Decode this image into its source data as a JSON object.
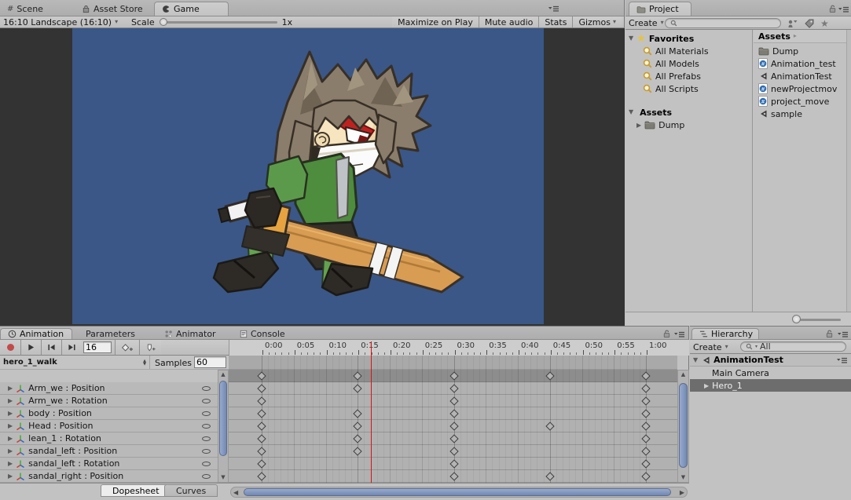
{
  "game_panel": {
    "tabs": [
      {
        "label": "Scene",
        "icon": "scene-icon",
        "active": false
      },
      {
        "label": "Asset Store",
        "icon": "asset-store-icon",
        "active": false
      },
      {
        "label": "Game",
        "icon": "game-icon",
        "active": true
      }
    ],
    "toolbar": {
      "aspect_dropdown": "16:10 Landscape (16:10)",
      "scale_label": "Scale",
      "scale_value": "1x",
      "maximize_on_play": "Maximize on Play",
      "mute_audio": "Mute audio",
      "stats": "Stats",
      "gizmos": "Gizmos"
    }
  },
  "project_panel": {
    "tab": "Project",
    "create_button": "Create",
    "search_placeholder": "",
    "favorites": {
      "label": "Favorites",
      "items": [
        "All Materials",
        "All Models",
        "All Prefabs",
        "All Scripts"
      ]
    },
    "assets_tree": {
      "label": "Assets",
      "children": [
        {
          "name": "Dump"
        }
      ]
    },
    "assets_list": {
      "header": "Assets",
      "items": [
        {
          "name": "Dump",
          "icon": "folder"
        },
        {
          "name": "Animation_test",
          "icon": "csharp-script"
        },
        {
          "name": "AnimationTest",
          "icon": "unity-asset"
        },
        {
          "name": "newProjectmov",
          "icon": "csharp-script"
        },
        {
          "name": "project_move",
          "icon": "csharp-script"
        },
        {
          "name": "sample",
          "icon": "unity-asset"
        }
      ]
    }
  },
  "animation_panel": {
    "tabs": [
      {
        "label": "Animation",
        "icon": "clock-icon",
        "active": true
      },
      {
        "label": "Parameters",
        "icon": "",
        "active": false
      },
      {
        "label": "Animator",
        "icon": "animator-icon",
        "active": false
      },
      {
        "label": "Console",
        "icon": "console-icon",
        "active": false
      }
    ],
    "transport": {
      "frame_value": "16"
    },
    "clip_selector": "hero_1_walk",
    "samples_label": "Samples",
    "samples_value": "60",
    "timeline": {
      "tick_labels": [
        "0:00",
        "0:05",
        "0:10",
        "0:15",
        "0:20",
        "0:25",
        "0:30",
        "0:35",
        "0:40",
        "0:45",
        "0:50",
        "0:55",
        "1:00"
      ],
      "total_frames": 60,
      "playhead_frame": 17
    },
    "dopesheet": {
      "summary_keys": [
        0,
        15,
        30,
        45,
        60
      ],
      "rows": [
        {
          "name": "Arm_we : Position",
          "keys": [
            0,
            15,
            30,
            60
          ]
        },
        {
          "name": "Arm_we : Rotation",
          "keys": [
            0,
            30,
            60
          ]
        },
        {
          "name": "body : Position",
          "keys": [
            0,
            15,
            30,
            60
          ]
        },
        {
          "name": "Head : Position",
          "keys": [
            0,
            15,
            30,
            45,
            60
          ]
        },
        {
          "name": "lean_1 : Rotation",
          "keys": [
            0,
            15,
            30,
            60
          ]
        },
        {
          "name": "sandal_left : Position",
          "keys": [
            0,
            15,
            30,
            60
          ]
        },
        {
          "name": "sandal_left : Rotation",
          "keys": [
            0,
            30,
            60
          ]
        },
        {
          "name": "sandal_right : Position",
          "keys": [
            0,
            30,
            45,
            60
          ]
        }
      ]
    },
    "bottom_tabs": [
      {
        "label": "Dopesheet",
        "active": true
      },
      {
        "label": "Curves",
        "active": false
      }
    ]
  },
  "hierarchy_panel": {
    "tab": "Hierarchy",
    "create_button": "Create",
    "search_scope": "All",
    "scene_root": "AnimationTest",
    "items": [
      {
        "name": "Main Camera",
        "selected": false,
        "has_children": false
      },
      {
        "name": "Hero_1",
        "selected": true,
        "has_children": true
      }
    ]
  },
  "colors": {
    "game_background": "#3a5787",
    "playhead": "#d81410",
    "record_red": "#c34a4a",
    "scrollbar_thumb": "#7f95bd",
    "selection": "#6d6d6d"
  }
}
